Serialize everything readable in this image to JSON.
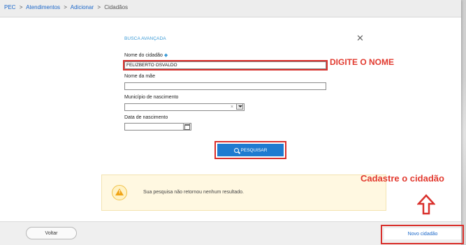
{
  "breadcrumb": {
    "items": [
      "PEC",
      "Atendimentos",
      "Adicionar"
    ],
    "separator": ">",
    "current": "Cidadãos"
  },
  "panel": {
    "title": "BUSCA AVANÇADA",
    "close_icon": "close-icon"
  },
  "form": {
    "nome": {
      "label": "Nome do cidadão",
      "required_marker": "◆",
      "value": "FELIZBERTO OSVALDO"
    },
    "nome_mae": {
      "label": "Nome da mãe",
      "value": ""
    },
    "municipio": {
      "label": "Município de nascimento",
      "value": "",
      "clear_glyph": "×"
    },
    "data_nasc": {
      "label": "Data de nascimento",
      "value": ""
    }
  },
  "search_button": {
    "label": "PESQUISAR",
    "icon": "search-icon"
  },
  "alert": {
    "icon": "warning-icon",
    "text": "Sua pesquisa não retornou nenhum resultado."
  },
  "footer": {
    "back_label": "Voltar",
    "new_label": "Novo cidadão"
  },
  "annotations": {
    "digite": "DIGITE O NOME",
    "cadastre": "Cadastre o cidadão"
  },
  "colors": {
    "link": "#1b67c9",
    "primary": "#1f7bd0",
    "annotation_red": "#e23a2f",
    "alert_bg": "#fff8e1",
    "warning": "#f0a416"
  }
}
